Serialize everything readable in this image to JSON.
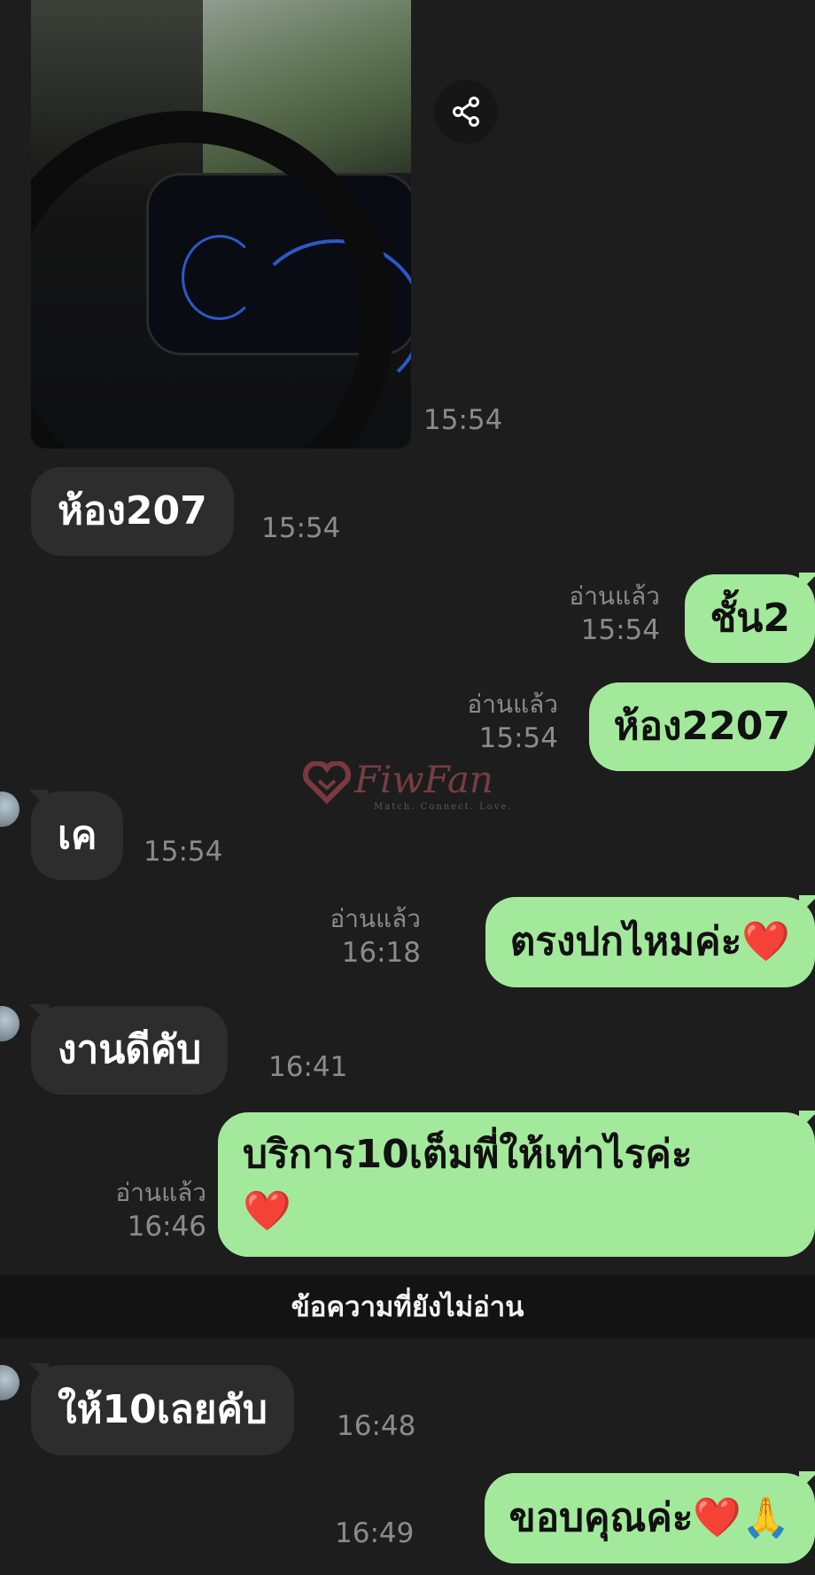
{
  "photo": {
    "time": "15:54"
  },
  "watermark": {
    "brand": "FiwFan",
    "slogan": "Match. Connect. Love."
  },
  "messages": [
    {
      "text": "ห้อง207",
      "time": "15:54"
    },
    {
      "text": "ชั้น2",
      "status": "อ่านแล้ว",
      "time": "15:54"
    },
    {
      "text": "ห้อง2207",
      "status": "อ่านแล้ว",
      "time": "15:54"
    },
    {
      "text": "เค",
      "time": "15:54"
    },
    {
      "text": "ตรงปกไหมค่ะ",
      "emoji": "❤️",
      "status": "อ่านแล้ว",
      "time": "16:18"
    },
    {
      "text": "งานดีคับ",
      "time": "16:41"
    },
    {
      "text": "บริการ10เต็มพี่ให้เท่าไรค่ะ",
      "emoji": "❤️",
      "status": "อ่านแล้ว",
      "time": "16:46"
    },
    {
      "text": "ให้10เลยคับ",
      "time": "16:48"
    },
    {
      "text": "ขอบคุณค่ะ",
      "emoji": "❤️🙏",
      "time": "16:49"
    }
  ],
  "unread_divider": "ข้อความที่ยังไม่อ่าน",
  "icons": {
    "share": "share-icon",
    "avatar": "avatar"
  }
}
